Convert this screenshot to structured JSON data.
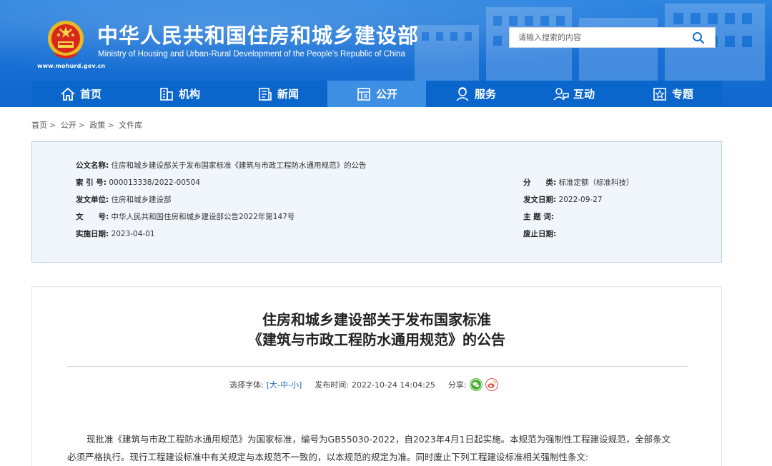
{
  "header": {
    "site_url": "www.mohurd.gov.cn",
    "title_cn": "中华人民共和国住房和城乡建设部",
    "title_en": "Ministry of Housing and Urban-Rural Development of the People's Republic of China",
    "search_placeholder": "请输入搜索的内容"
  },
  "nav": {
    "items": [
      {
        "label": "首页",
        "icon": "home-icon"
      },
      {
        "label": "机构",
        "icon": "building-icon"
      },
      {
        "label": "新闻",
        "icon": "news-icon"
      },
      {
        "label": "公开",
        "icon": "open-info-icon"
      },
      {
        "label": "服务",
        "icon": "service-icon"
      },
      {
        "label": "互动",
        "icon": "interact-icon"
      },
      {
        "label": "专题",
        "icon": "topic-icon"
      }
    ],
    "active_index": 3,
    "colors": {
      "bar": "#0b66cc",
      "active": "#3d8fe3",
      "header": "#1a72d6"
    }
  },
  "breadcrumb": [
    "首页",
    "公开",
    "政策",
    "文件库"
  ],
  "breadcrumb_sep": ">",
  "info": {
    "name_label": "公文名称:",
    "name_value": "住房和城乡建设部关于发布国家标准《建筑与市政工程防水通用规范》的公告",
    "index_label": "索 引 号:",
    "index_value": "000013338/2022-00504",
    "category_label": "分　　类:",
    "category_value": "标准定额（标准科技）",
    "issuer_label": "发文单位:",
    "issuer_value": "住房和城乡建设部",
    "issue_date_label": "发文日期:",
    "issue_date_value": "2022-09-27",
    "doc_no_label": "文　　号:",
    "doc_no_value": "中华人民共和国住房和城乡建设部公告2022年第147号",
    "subject_label": "主 题 词:",
    "subject_value": "",
    "effective_label": "实施日期:",
    "effective_value": "2023-04-01",
    "expire_label": "废止日期:",
    "expire_value": ""
  },
  "article": {
    "title_line1": "住房和城乡建设部关于发布国家标准",
    "title_line2": "《建筑与市政工程防水通用规范》的公告",
    "font_label": "选择字体:",
    "font_open": "[",
    "font_large": "大",
    "font_mid": "中",
    "font_small": "小",
    "font_dash": "-",
    "font_close": "]",
    "publish_label": "发布时间:",
    "publish_time": "2022-10-24 14:04:25",
    "share_label": "分享:",
    "para1_line1": "现批准《建筑与市政工程防水通用规范》为国家标准，编号为GB55030-2022，自2023年4月1日起实施。本规范为强制性工程建设规范，全部条文",
    "para1_line2": "必须严格执行。现行工程建设标准中有关规定与本规范不一致的，以本规范的规定为准。同时废止下列工程建设标准相关强制性条文:"
  }
}
